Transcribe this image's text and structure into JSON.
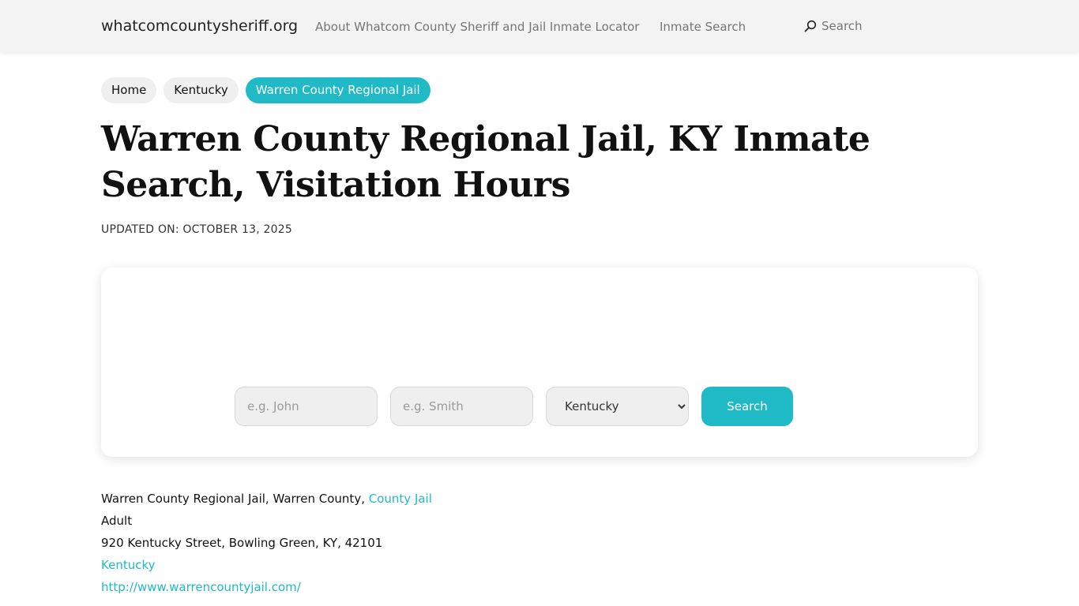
{
  "header": {
    "brand": "whatcomcountysheriff.org",
    "nav_about": "About Whatcom County Sheriff and Jail Inmate Locator",
    "nav_inmate_search": "Inmate Search",
    "nav_search": "Search",
    "search_icon": "search-icon"
  },
  "breadcrumb": {
    "items": [
      {
        "label": "Home"
      },
      {
        "label": "Kentucky"
      },
      {
        "label": "Warren County Regional Jail"
      }
    ]
  },
  "page": {
    "title": "Warren County Regional Jail, KY Inmate Search, Visitation Hours",
    "updated": "UPDATED ON: OCTOBER 13, 2025"
  },
  "search_form": {
    "first_name_placeholder": "e.g. John",
    "last_name_placeholder": "e.g. Smith",
    "state_selected": "Kentucky",
    "submit_label": "Search"
  },
  "facility": {
    "name_text": "Warren County Regional Jail, Warren County, ",
    "type_link": "County Jail",
    "population": "Adult",
    "address": "920 Kentucky Street, Bowling Green, KY, 42101",
    "state_link": "Kentucky",
    "website": "http://www.warrencountyjail.com/"
  },
  "colors": {
    "accent": "#1fbac6",
    "header_bg": "#f3f3f3"
  }
}
